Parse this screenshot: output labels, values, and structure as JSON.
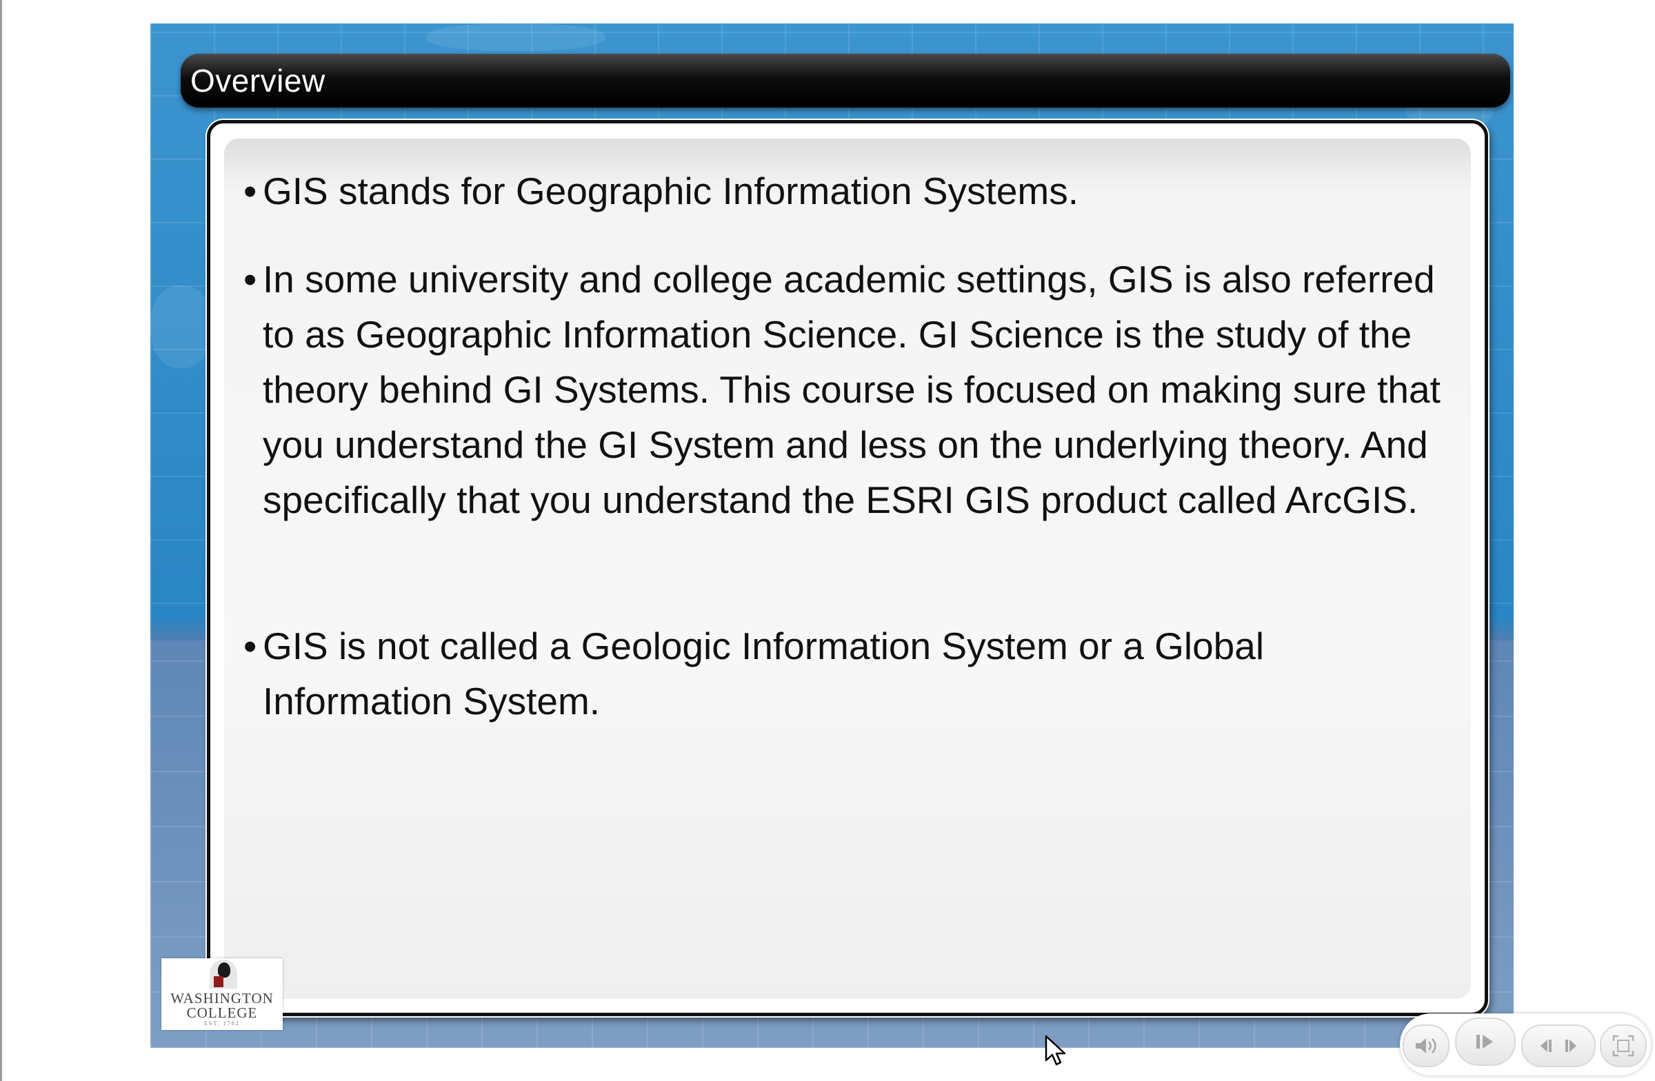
{
  "slide": {
    "title": "Overview",
    "bullets": [
      "GIS stands for Geographic Information Systems.",
      "In some university and college academic settings, GIS is also referred to as Geographic Information Science.   GI Science is the study of the theory behind GI Systems.  This course is focused on making sure that you understand the GI System and less on the underlying theory.  And specifically that you understand the ESRI GIS product called ArcGIS.",
      "GIS is not called a Geologic Information System or a Global Information System."
    ],
    "bullet_glyph": "•"
  },
  "logo": {
    "line1": "WASHINGTON",
    "line2": "COLLEGE",
    "line3": "EST. 1782"
  },
  "player": {
    "icons": [
      "volume-icon",
      "play-pause-icon",
      "previous-slide-icon",
      "next-slide-icon",
      "fullscreen-icon"
    ]
  },
  "colors": {
    "stage_blue": "#2a85c4",
    "title_bar": "#000000",
    "panel": "#f7f7f7"
  }
}
